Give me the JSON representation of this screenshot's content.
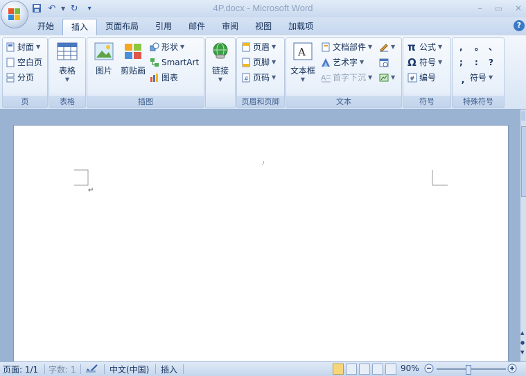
{
  "window": {
    "title": "4P.docx - Microsoft Word",
    "controls": [
      "–",
      "▭",
      "✕"
    ]
  },
  "qat": {
    "icons": [
      "save-icon",
      "undo-icon",
      "redo-icon",
      "qat-more-icon"
    ]
  },
  "tabs": [
    {
      "label": "开始",
      "active": false
    },
    {
      "label": "插入",
      "active": true
    },
    {
      "label": "页面布局",
      "active": false
    },
    {
      "label": "引用",
      "active": false
    },
    {
      "label": "邮件",
      "active": false
    },
    {
      "label": "审阅",
      "active": false
    },
    {
      "label": "视图",
      "active": false
    },
    {
      "label": "加载项",
      "active": false
    }
  ],
  "help": "?",
  "ribbon": {
    "pages": {
      "label": "页",
      "cover": "封面",
      "blank": "空白页",
      "break": "分页"
    },
    "tables": {
      "label": "表格",
      "table": "表格"
    },
    "illustrations": {
      "label": "插图",
      "picture": "图片",
      "clipart": "剪贴画",
      "shapes": "形状",
      "smartart": "SmartArt",
      "chart": "图表"
    },
    "links": {
      "label": "",
      "link": "链接"
    },
    "header_footer": {
      "label": "页眉和页脚",
      "header": "页眉",
      "footer": "页脚",
      "page_number": "页码"
    },
    "text": {
      "label": "文本",
      "textbox": "文本框",
      "quick_parts": "文档部件",
      "wordart": "艺术字",
      "dropcap": "首字下沉"
    },
    "symbols": {
      "label": "符号",
      "equation": "公式",
      "symbol": "符号",
      "number": "编号"
    },
    "special": {
      "label": "特殊符号",
      "chars": [
        ",",
        "。",
        "、",
        ";",
        ":",
        "?"
      ],
      "symbol": "符号"
    }
  },
  "status": {
    "page": "页面: 1/1",
    "words": "字数: 1",
    "language": "中文(中国)",
    "mode": "插入",
    "zoom": "90%"
  },
  "colors": {
    "accent": "#2c5aa0",
    "ribbon_bg": "#dbe6f4",
    "doc_bg": "#9ab3d2"
  }
}
